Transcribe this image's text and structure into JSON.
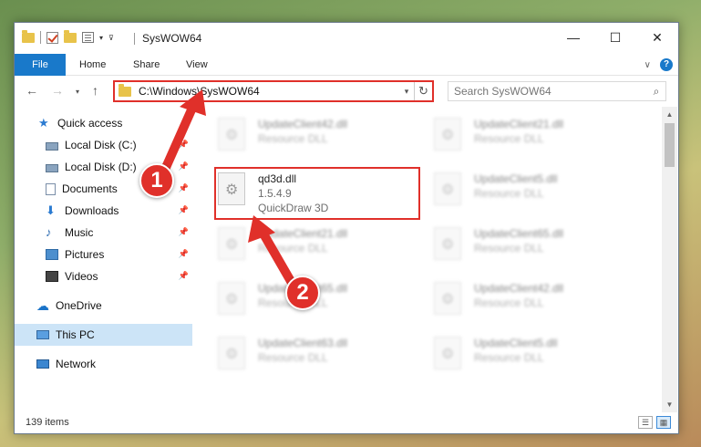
{
  "window": {
    "title": "SysWOW64"
  },
  "ribbon": {
    "tabs": [
      {
        "label": "File"
      },
      {
        "label": "Home"
      },
      {
        "label": "Share"
      },
      {
        "label": "View"
      }
    ],
    "help_label": "?"
  },
  "window_controls": {
    "minimize": "—",
    "maximize": "☐",
    "close": "✕"
  },
  "nav": {
    "back": "←",
    "forward": "→",
    "recent": "▾",
    "up": "↑",
    "address": "C:\\Windows\\SysWOW64",
    "refresh": "↻",
    "search_placeholder": "Search SysWOW64"
  },
  "sidebar": {
    "items": [
      {
        "label": "Quick access",
        "icon": "star-icon",
        "pinned": false
      },
      {
        "label": "Local Disk (C:)",
        "icon": "disk-icon",
        "pinned": true
      },
      {
        "label": "Local Disk (D:)",
        "icon": "disk-icon",
        "pinned": true
      },
      {
        "label": "Documents",
        "icon": "documents-icon",
        "pinned": true
      },
      {
        "label": "Downloads",
        "icon": "download-icon",
        "pinned": true
      },
      {
        "label": "Music",
        "icon": "music-icon",
        "pinned": true
      },
      {
        "label": "Pictures",
        "icon": "pictures-icon",
        "pinned": true
      },
      {
        "label": "Videos",
        "icon": "videos-icon",
        "pinned": true
      },
      {
        "label": "OneDrive",
        "icon": "cloud-icon",
        "pinned": false
      },
      {
        "label": "This PC",
        "icon": "computer-icon",
        "pinned": false,
        "selected": true
      },
      {
        "label": "Network",
        "icon": "network-icon",
        "pinned": false
      }
    ]
  },
  "files": {
    "highlighted": {
      "name": "qd3d.dll",
      "version": "1.5.4.9",
      "description": "QuickDraw 3D"
    },
    "blurred": [
      {
        "name": "UpdateClient42.dll",
        "description": "Resource DLL"
      },
      {
        "name": "UpdateClient21.dll",
        "description": "Resource DLL"
      },
      {
        "name": "UpdateClient5.dll",
        "description": "Resource DLL"
      },
      {
        "name": "UpdateClient21.dll",
        "description": "Resource DLL"
      },
      {
        "name": "UpdateClient65.dll",
        "description": "Resource DLL"
      },
      {
        "name": "UpdateClient65.dll",
        "description": "Resource DLL"
      },
      {
        "name": "UpdateClient42.dll",
        "description": "Resource DLL"
      },
      {
        "name": "UpdateClient63.dll",
        "description": "Resource DLL"
      },
      {
        "name": "UpdateClient5.dll",
        "description": "Resource DLL"
      }
    ]
  },
  "status": {
    "item_count": "139 items"
  },
  "annotations": {
    "step1": "1",
    "step2": "2"
  },
  "colors": {
    "accent": "#1979ca",
    "annotation_red": "#e0302a",
    "selected_bg": "#cce4f7"
  }
}
